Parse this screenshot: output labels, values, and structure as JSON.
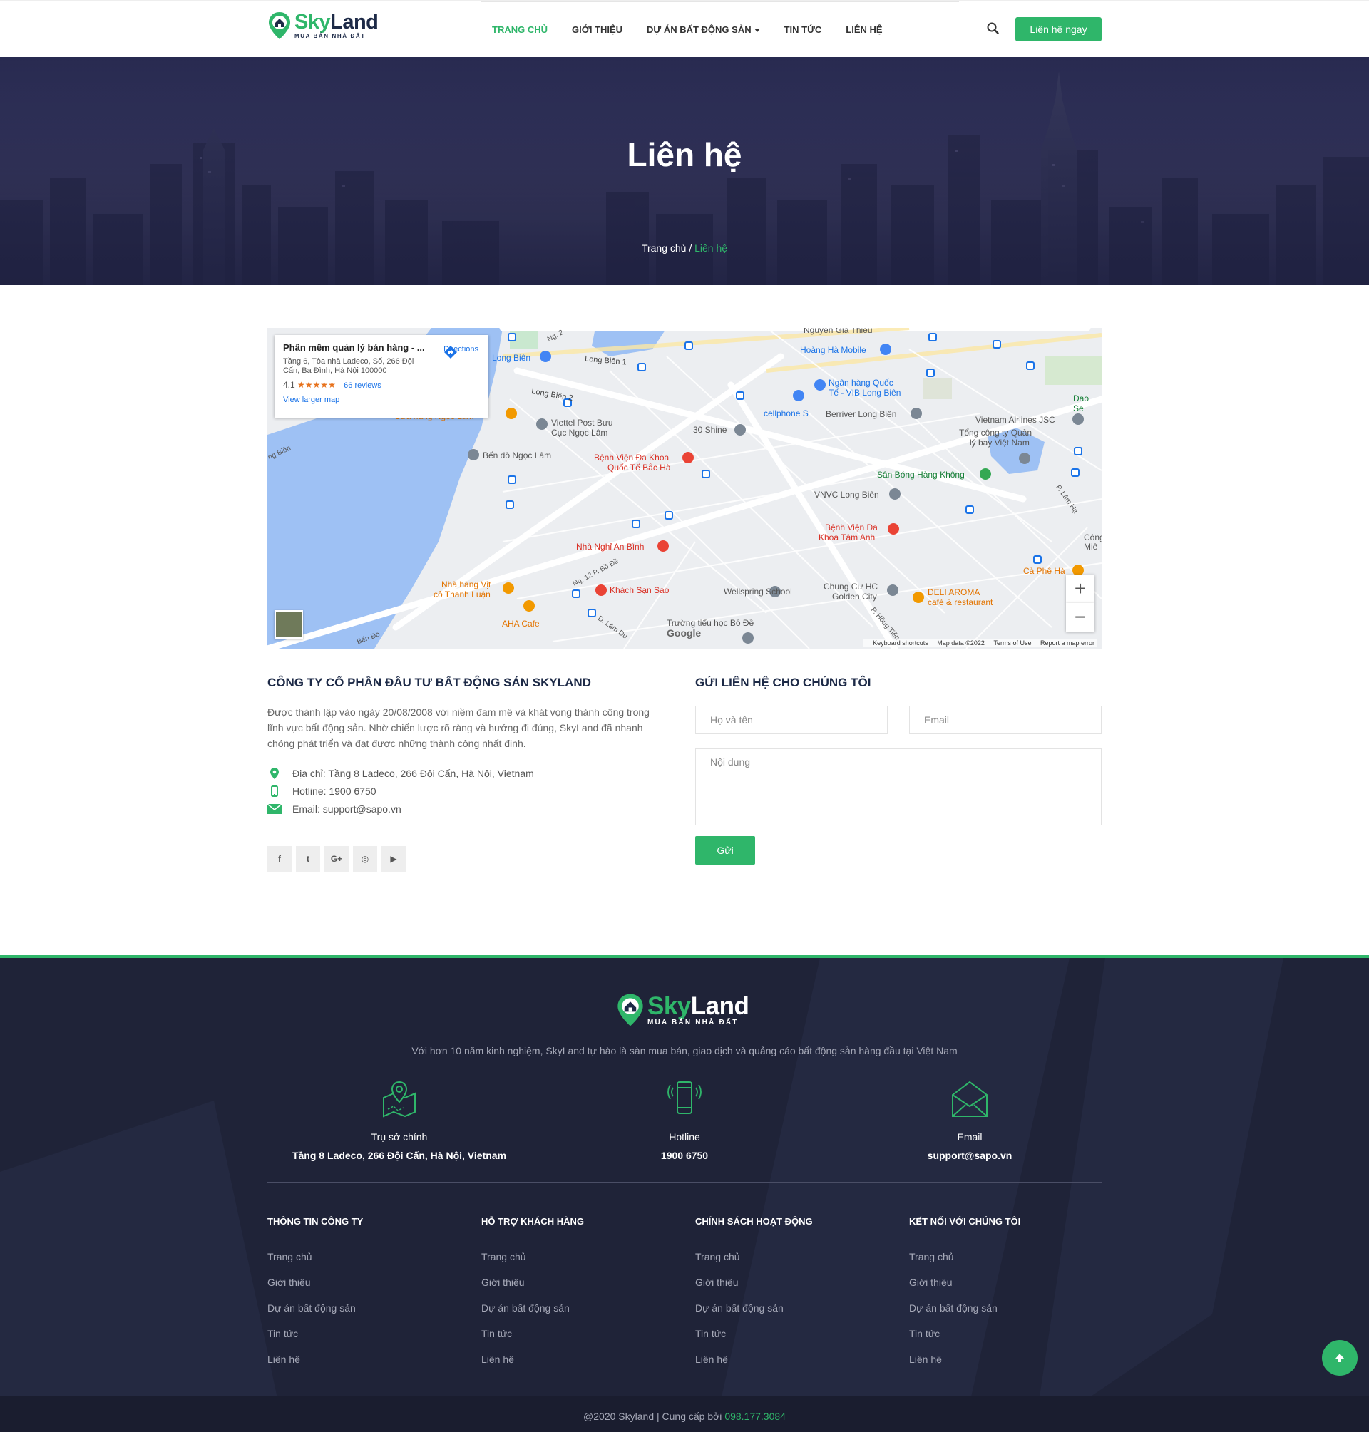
{
  "header": {
    "logo": {
      "sky": "Sky",
      "land": "Land",
      "tagline": "MUA BÁN NHÀ ĐẤT"
    },
    "nav": [
      {
        "label": "TRANG CHỦ",
        "active": true
      },
      {
        "label": "GIỚI THIỆU",
        "active": false
      },
      {
        "label": "DỰ ÁN BẤT ĐỘNG SẢN",
        "active": false,
        "dropdown": true
      },
      {
        "label": "TIN TỨC",
        "active": false
      },
      {
        "label": "LIÊN HỆ",
        "active": false
      }
    ],
    "search_icon": "search-icon",
    "cta": "Liên hệ ngay"
  },
  "banner": {
    "title": "Liên hệ",
    "breadcrumb_home": "Trang chủ",
    "breadcrumb_sep": " / ",
    "breadcrumb_current": "Liên hệ"
  },
  "map": {
    "card_title": "Phần mềm quản lý bán hàng - ...",
    "card_address": "Tầng 6, Tòa nhà Ladeco, Số, 266 Đội Cấn, Ba Đình, Hà Nội 100000",
    "rating": "4.1",
    "stars": "★★★★★",
    "reviews": "66 reviews",
    "larger_map": "View larger map",
    "directions": "Directions",
    "zoom_in": "+",
    "zoom_out": "−",
    "google": "Google",
    "footer_links": [
      "Keyboard shortcuts",
      "Map data ©2022",
      "Terms of Use",
      "Report a map error"
    ],
    "labels": [
      "Long Biên",
      "Long Biên 1",
      "Long Biên 2",
      "Nguyễn Gia Thiều",
      "Hoàng Hà Mobile",
      "Ngân hàng Quốc",
      "Tế - VIB Long Biên",
      "cellphone S",
      "Berriver Long Biên",
      "Dao Se",
      "Viettel Post Bưu",
      "Cục Ngọc Lâm",
      "30 Shine",
      "Vietnam Airlines JSC",
      "Tổng công ty Quản",
      "lý bay Việt Nam",
      "Bến đò Ngọc Lâm",
      "Bệnh Viện Đa Khoa",
      "Quốc Tế Bắc Hà",
      "Sân Bóng Hàng Không",
      "VNVC Long Biên",
      "Nhà Nghỉ An Bình",
      "Bệnh Viện Đa",
      "Khoa Tâm Anh",
      "Nhà hàng Vịt",
      "cỏ Thanh Luận",
      "Khách Sạn Sao",
      "Wellspring School",
      "Chung Cư HC",
      "Golden City",
      "DELI AROMA",
      "café & restaurant",
      "Cà Phê Hà",
      "AHA Cafe",
      "Trường tiểu học Bồ Đề",
      "Ng. 12 P. Bồ Đề",
      "D. Lâm Du",
      "P. Hồng Tiến",
      "P. Lâm Hạ",
      "Ng. 2",
      "Bến Đò",
      "Cửa hàng Ngọc Lâm",
      "Công",
      "Miê",
      "ng Biên"
    ]
  },
  "company": {
    "title": "CÔNG TY CỔ PHẦN ĐẦU TƯ BẤT ĐỘNG SẢN SKYLAND",
    "description": "Được thành lập vào ngày 20/08/2008 với niềm đam mê và khát vọng thành công trong lĩnh vực bất động sản. Nhờ chiến lược rõ ràng và hướng đi đúng, SkyLand đã nhanh chóng phát triển và đạt được những thành công nhất định.",
    "address": "Địa chỉ: Tầng 8 Ladeco, 266 Đội Cấn, Hà Nội, Vietnam",
    "hotline": "Hotline: 1900 6750",
    "email": "Email: support@sapo.vn",
    "socials": [
      {
        "icon": "facebook-icon",
        "glyph": "f"
      },
      {
        "icon": "twitter-icon",
        "glyph": "t"
      },
      {
        "icon": "google-plus-icon",
        "glyph": "G+"
      },
      {
        "icon": "instagram-icon",
        "glyph": "◎"
      },
      {
        "icon": "youtube-icon",
        "glyph": "▶"
      }
    ]
  },
  "form": {
    "title": "GỬI LIÊN HỆ CHO CHÚNG TÔI",
    "name_placeholder": "Họ và tên",
    "email_placeholder": "Email",
    "content_placeholder": "Nội dung",
    "submit": "Gửi"
  },
  "footer": {
    "logo": {
      "sky": "Sky",
      "land": "Land",
      "tagline": "MUA BÁN NHÀ ĐẤT"
    },
    "description": "Với hơn 10 năm kinh nghiệm, SkyLand tự hào là sàn mua bán, giao dịch và quảng cáo bất động sản hàng đầu tại Việt Nam",
    "contacts": [
      {
        "label": "Trụ sở chính",
        "value": "Tầng 8 Ladeco, 266 Đội Cấn, Hà Nội, Vietnam",
        "icon": "map-location-icon"
      },
      {
        "label": "Hotline",
        "value": "1900 6750",
        "icon": "phone-icon"
      },
      {
        "label": "Email",
        "value": "support@sapo.vn",
        "icon": "envelope-icon"
      }
    ],
    "columns": [
      {
        "title": "THÔNG TIN CÔNG TY",
        "links": [
          "Trang chủ",
          "Giới thiệu",
          "Dự án bất động sản",
          "Tin tức",
          "Liên hệ"
        ]
      },
      {
        "title": "HỖ TRỢ KHÁCH HÀNG",
        "links": [
          "Trang chủ",
          "Giới thiệu",
          "Dự án bất động sản",
          "Tin tức",
          "Liên hệ"
        ]
      },
      {
        "title": "CHÍNH SÁCH HOẠT ĐỘNG",
        "links": [
          "Trang chủ",
          "Giới thiệu",
          "Dự án bất động sản",
          "Tin tức",
          "Liên hệ"
        ]
      },
      {
        "title": "KẾT NỐI VỚI CHÚNG TÔI",
        "links": [
          "Trang chủ",
          "Giới thiệu",
          "Dự án bất động sản",
          "Tin tức",
          "Liên hệ"
        ]
      }
    ],
    "copyright": "@2020 Skyland | Cung cấp bởi ",
    "phone": "098.177.3084"
  },
  "colors": {
    "accent": "#2fb66a",
    "navy": "#1d2a47",
    "footer_bg": "#1f2338"
  }
}
